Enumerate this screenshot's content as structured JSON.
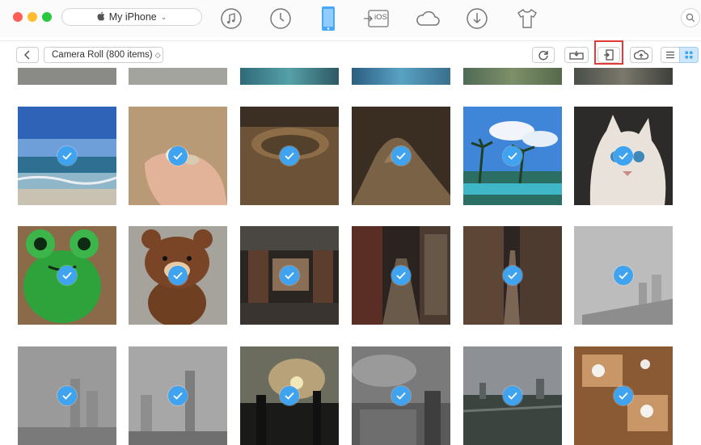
{
  "window": {
    "traffic_lights": [
      "#ff5f57",
      "#febc2e",
      "#28c840"
    ]
  },
  "device": {
    "label": "My iPhone"
  },
  "nav_icons": [
    "music-icon",
    "history-icon",
    "phone-icon",
    "ios-transfer-icon",
    "icloud-icon",
    "download-icon",
    "tshirt-icon"
  ],
  "nav_ios_label": "iOS",
  "toolbar": {
    "album_label": "Camera Roll (800 items)"
  },
  "colors": {
    "accent": "#3fa3f0",
    "highlight": "#e53935"
  },
  "photos": [
    {
      "subject": "beach-horizon",
      "selected": true
    },
    {
      "subject": "hand-with-shells",
      "selected": true
    },
    {
      "subject": "sand-crater",
      "selected": true
    },
    {
      "subject": "sand-mound",
      "selected": true
    },
    {
      "subject": "palm-trees-pool",
      "selected": true
    },
    {
      "subject": "white-cat",
      "selected": true
    },
    {
      "subject": "green-frog-figure",
      "selected": true
    },
    {
      "subject": "brown-bear-figure",
      "selected": true
    },
    {
      "subject": "library-hall",
      "selected": true
    },
    {
      "subject": "bookshelf-corridor",
      "selected": true
    },
    {
      "subject": "bookshelf-aisle",
      "selected": true
    },
    {
      "subject": "foggy-skyline",
      "selected": true
    },
    {
      "subject": "hazy-city-1",
      "selected": true
    },
    {
      "subject": "hazy-city-2",
      "selected": true
    },
    {
      "subject": "sunset-skyline",
      "selected": true
    },
    {
      "subject": "cloudy-city",
      "selected": true
    },
    {
      "subject": "city-overview",
      "selected": true
    },
    {
      "subject": "table-setting",
      "selected": true
    }
  ]
}
